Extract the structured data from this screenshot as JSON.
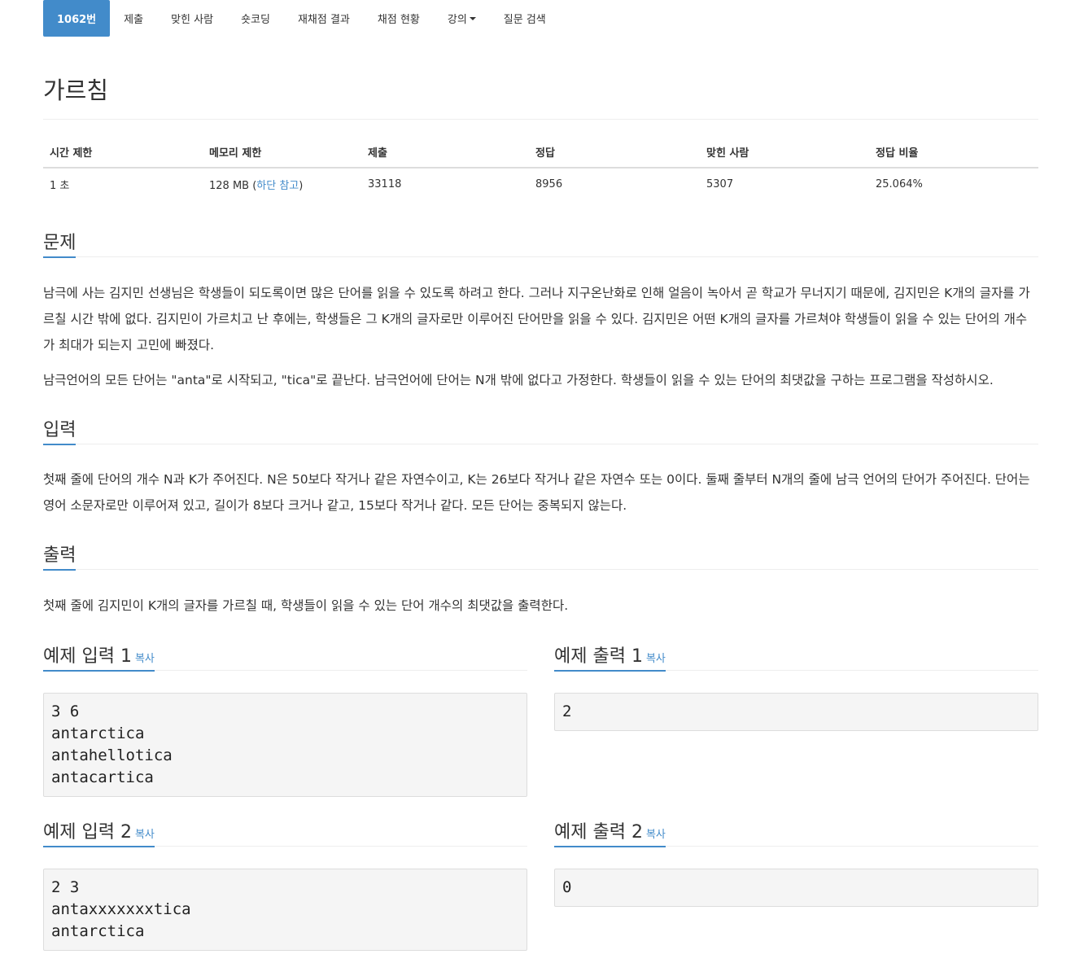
{
  "tabs": [
    {
      "label": "1062번"
    },
    {
      "label": "제출"
    },
    {
      "label": "맞힌 사람"
    },
    {
      "label": "숏코딩"
    },
    {
      "label": "재채점 결과"
    },
    {
      "label": "채점 현황"
    },
    {
      "label": "강의"
    },
    {
      "label": "질문 검색"
    }
  ],
  "title": "가르침",
  "info": {
    "headers": [
      "시간 제한",
      "메모리 제한",
      "제출",
      "정답",
      "맞힌 사람",
      "정답 비율"
    ],
    "time_limit": "1 초",
    "memory_limit_value": "128 MB (",
    "memory_limit_link": "하단 참고",
    "memory_limit_close": ")",
    "submissions": "33118",
    "accepted": "8956",
    "solvers": "5307",
    "ratio": "25.064%"
  },
  "sections": {
    "problem": {
      "heading": "문제",
      "paragraphs": [
        "남극에 사는 김지민 선생님은 학생들이 되도록이면 많은 단어를 읽을 수 있도록 하려고 한다. 그러나 지구온난화로 인해 얼음이 녹아서 곧 학교가 무너지기 때문에, 김지민은 K개의 글자를 가르칠 시간 밖에 없다. 김지민이 가르치고 난 후에는, 학생들은 그 K개의 글자로만 이루어진 단어만을 읽을 수 있다. 김지민은 어떤 K개의 글자를 가르쳐야 학생들이 읽을 수 있는 단어의 개수가 최대가 되는지 고민에 빠졌다.",
        "남극언어의 모든 단어는 \"anta\"로 시작되고, \"tica\"로 끝난다. 남극언어에 단어는 N개 밖에 없다고 가정한다. 학생들이 읽을 수 있는 단어의 최댓값을 구하는 프로그램을 작성하시오."
      ]
    },
    "input": {
      "heading": "입력",
      "text": "첫째 줄에 단어의 개수 N과 K가 주어진다. N은 50보다 작거나 같은 자연수이고, K는 26보다 작거나 같은 자연수 또는 0이다. 둘째 줄부터 N개의 줄에 남극 언어의 단어가 주어진다. 단어는 영어 소문자로만 이루어져 있고, 길이가 8보다 크거나 같고, 15보다 작거나 같다. 모든 단어는 중복되지 않는다."
    },
    "output": {
      "heading": "출력",
      "text": "첫째 줄에 김지민이 K개의 글자를 가르칠 때, 학생들이 읽을 수 있는 단어 개수의 최댓값을 출력한다."
    }
  },
  "copy_label": "복사",
  "samples": [
    {
      "in_title": "예제 입력 1",
      "in": "3 6\nantarctica\nantahellotica\nantacartica",
      "out_title": "예제 출력 1",
      "out": "2"
    },
    {
      "in_title": "예제 입력 2",
      "in": "2 3\nantaxxxxxxxtica\nantarctica",
      "out_title": "예제 출력 2",
      "out": "0"
    }
  ],
  "colors": {
    "accent": "#428bca",
    "sample_bg": "#f5f5f5"
  }
}
